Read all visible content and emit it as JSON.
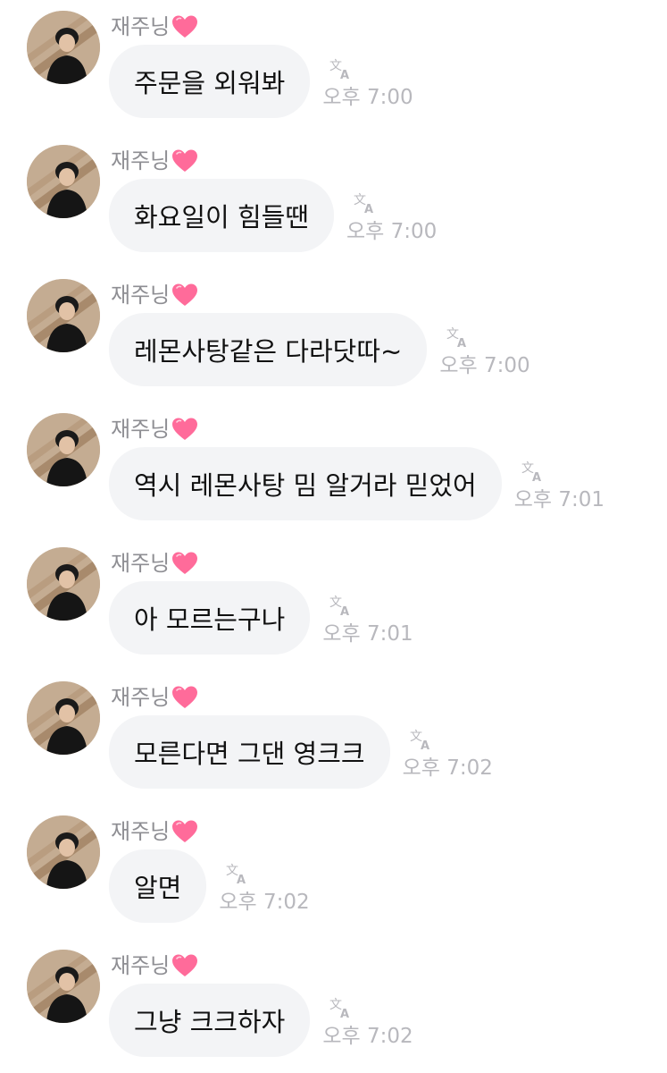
{
  "colors": {
    "bubble": "#f3f4f6",
    "sender_name": "#8e8e93",
    "time": "#b8b8bd",
    "heart": "#ff6b9a"
  },
  "icons": {
    "sender_badge": "pink-heart-icon",
    "translate": "translate-icon"
  },
  "messages": [
    {
      "sender": "재주닝",
      "text": "주문을 외워봐",
      "time": "오후 7:00"
    },
    {
      "sender": "재주닝",
      "text": "화요일이 힘들땐",
      "time": "오후 7:00"
    },
    {
      "sender": "재주닝",
      "text": "레몬사탕같은 다라닷따~",
      "time": "오후 7:00"
    },
    {
      "sender": "재주닝",
      "text": "역시 레몬사탕 밈 알거라 믿었어",
      "time": "오후 7:01"
    },
    {
      "sender": "재주닝",
      "text": "아 모르는구나",
      "time": "오후 7:01"
    },
    {
      "sender": "재주닝",
      "text": "모른다면 그댄 영크크",
      "time": "오후 7:02"
    },
    {
      "sender": "재주닝",
      "text": "알면",
      "time": "오후 7:02"
    },
    {
      "sender": "재주닝",
      "text": "그냥 크크하자",
      "time": "오후 7:02"
    }
  ]
}
